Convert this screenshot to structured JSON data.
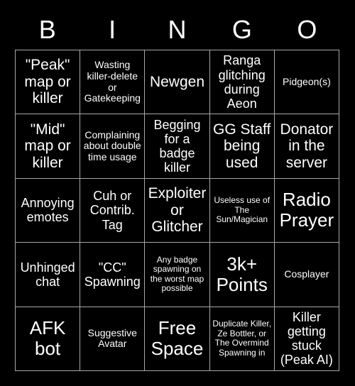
{
  "card": {
    "title_letters": [
      "B",
      "I",
      "N",
      "G",
      "O"
    ],
    "background_color": "#000000",
    "text_color": "#ffffff",
    "grid_line_color": "#a8a8a8",
    "columns": 5,
    "rows": 5,
    "cells": [
      {
        "text": "\"Peak\" map or killer",
        "size": "lg"
      },
      {
        "text": "Wasting killer-delete or Gatekeeping",
        "size": "sm"
      },
      {
        "text": "Newgen",
        "size": "lg"
      },
      {
        "text": "Ranga glitching during Aeon",
        "size": "md"
      },
      {
        "text": "Pidgeon(s)",
        "size": "sm"
      },
      {
        "text": "\"Mid\" map or killer",
        "size": "lg"
      },
      {
        "text": "Complaining about double time usage",
        "size": "sm"
      },
      {
        "text": "Begging for a badge killer",
        "size": "md"
      },
      {
        "text": "GG Staff being used",
        "size": "lg"
      },
      {
        "text": "Donator in the server",
        "size": "lg"
      },
      {
        "text": "Annoying emotes",
        "size": "md"
      },
      {
        "text": "Cuh or Contrib. Tag",
        "size": "md"
      },
      {
        "text": "Exploiter or Glitcher",
        "size": "lg"
      },
      {
        "text": "Useless use of The Sun/Magician",
        "size": "xs"
      },
      {
        "text": "Radio Prayer",
        "size": "xl"
      },
      {
        "text": "Unhinged chat",
        "size": "md"
      },
      {
        "text": "\"CC\" Spawning",
        "size": "md"
      },
      {
        "text": "Any badge spawning on the worst map possible",
        "size": "xs"
      },
      {
        "text": "3k+ Points",
        "size": "xl"
      },
      {
        "text": "Cosplayer",
        "size": "sm"
      },
      {
        "text": "AFK bot",
        "size": "xl"
      },
      {
        "text": "Suggestive Avatar",
        "size": "sm"
      },
      {
        "text": "Free Space",
        "size": "xl"
      },
      {
        "text": "Duplicate Killer, Ze Bottler, or The Overmind Spawning in",
        "size": "xs"
      },
      {
        "text": "Killer getting stuck (Peak AI)",
        "size": "md"
      }
    ]
  }
}
